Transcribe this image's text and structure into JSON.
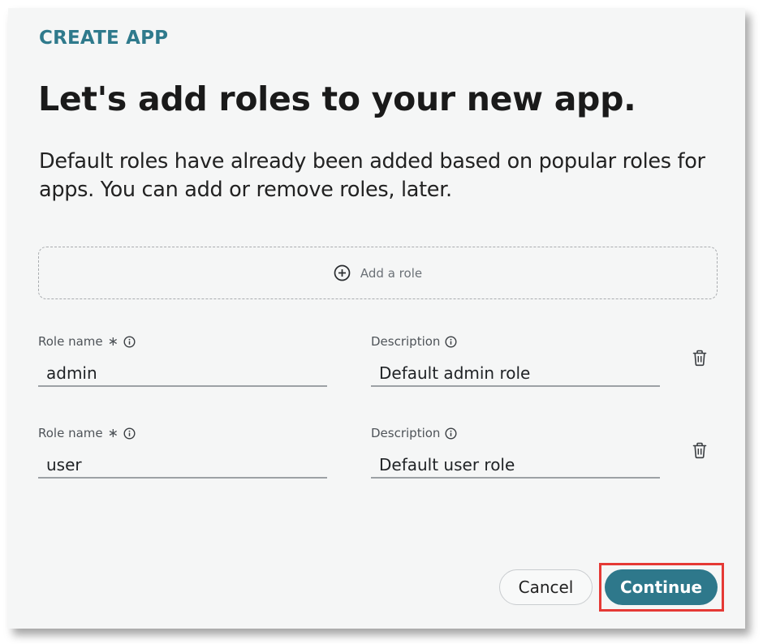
{
  "header": {
    "eyebrow": "CREATE APP",
    "title": "Let's add roles to your new app.",
    "subtitle": "Default roles have already been added based on popular roles for apps. You can add or remove roles, later."
  },
  "add_role": {
    "label": "Add a role",
    "icon": "plus-circle-icon"
  },
  "roles": [
    {
      "role_name_label": "Role name",
      "required_marker": "∗",
      "role_name_value": "admin",
      "description_label": "Description",
      "description_value": "Default admin role"
    },
    {
      "role_name_label": "Role name",
      "required_marker": "∗",
      "role_name_value": "user",
      "description_label": "Description",
      "description_value": "Default user role"
    }
  ],
  "footer": {
    "cancel_label": "Cancel",
    "continue_label": "Continue",
    "highlighted_button": "continue"
  },
  "colors": {
    "accent": "#2e788b",
    "eyebrow": "#2f7a8c",
    "panel_bg": "#f5f6f6",
    "highlight": "#e53935"
  }
}
